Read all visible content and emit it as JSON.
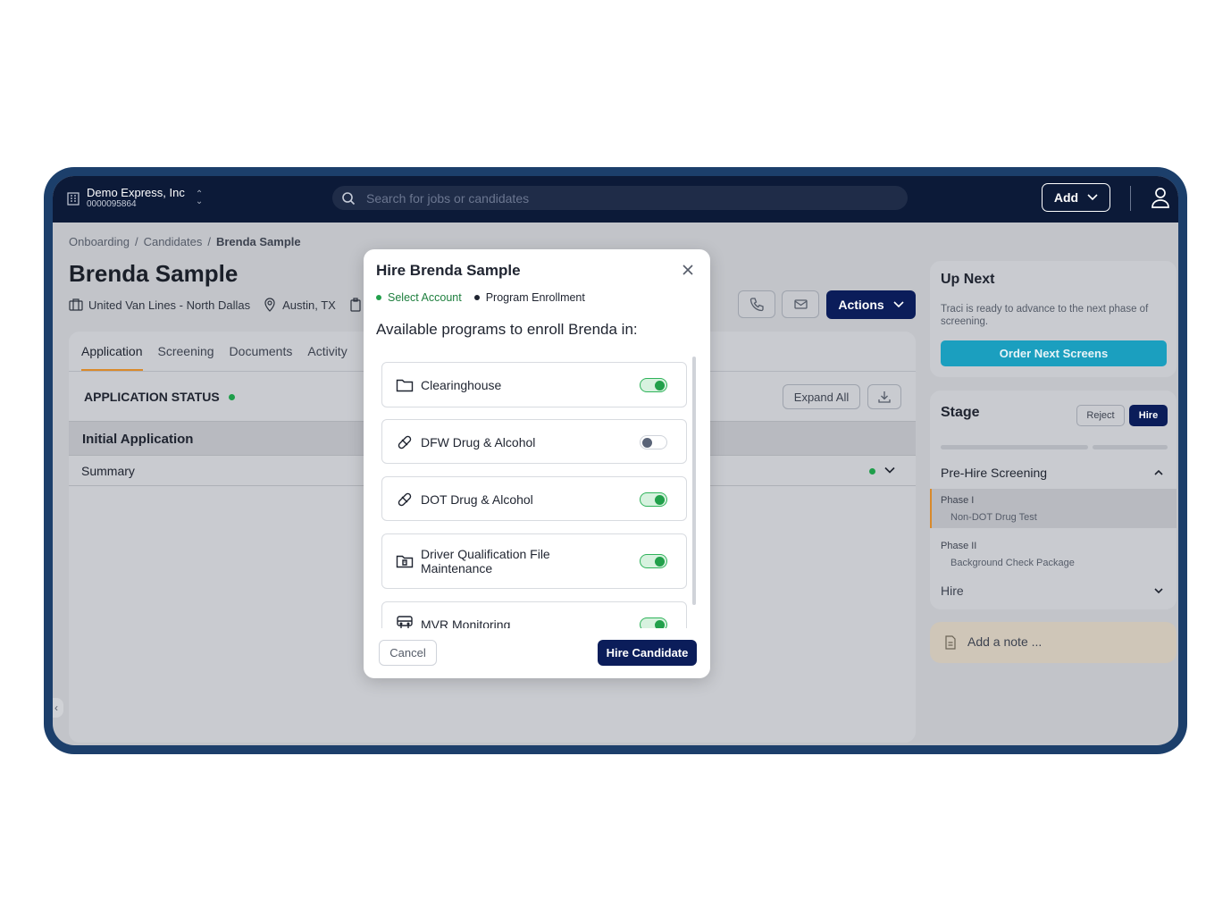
{
  "topbar": {
    "org_name": "Demo Express, Inc",
    "org_id": "0000095864",
    "search_placeholder": "Search for jobs or candidates",
    "add_label": "Add"
  },
  "breadcrumb": [
    "Onboarding",
    "Candidates",
    "Brenda Sample"
  ],
  "candidate": {
    "name": "Brenda Sample",
    "company": "United Van Lines - North Dallas",
    "location": "Austin, TX"
  },
  "header": {
    "actions_label": "Actions"
  },
  "tabs": [
    "Application",
    "Screening",
    "Documents",
    "Activity"
  ],
  "application": {
    "status_label": "APPLICATION STATUS",
    "expand_all_label": "Expand All",
    "section_title": "Initial Application",
    "summary_label": "Summary"
  },
  "up_next": {
    "title": "Up Next",
    "text": "Traci is ready to advance to the next phase of screening.",
    "button": "Order Next Screens"
  },
  "stage": {
    "title": "Stage",
    "reject_label": "Reject",
    "hire_label": "Hire",
    "group": "Pre-Hire Screening",
    "phases": [
      {
        "label": "Phase I",
        "desc": "Non-DOT Drug Test"
      },
      {
        "label": "Phase II",
        "desc": "Background Check Package"
      }
    ],
    "hire_row": "Hire"
  },
  "note": {
    "label": "Add a note ..."
  },
  "modal": {
    "title": "Hire Brenda Sample",
    "steps": [
      "Select Account",
      "Program Enrollment"
    ],
    "subtitle": "Available programs to enroll Brenda in:",
    "programs": [
      {
        "label": "Clearinghouse",
        "icon": "folder-icon",
        "enabled": true
      },
      {
        "label": "DFW Drug & Alcohol",
        "icon": "pill-icon",
        "enabled": false
      },
      {
        "label": "DOT Drug & Alcohol",
        "icon": "pill-icon",
        "enabled": true
      },
      {
        "label": "Driver Qualification File Maintenance",
        "icon": "folder-file-icon",
        "enabled": true
      },
      {
        "label": "MVR Monitoring",
        "icon": "truck-icon",
        "enabled": true
      }
    ],
    "cancel_label": "Cancel",
    "confirm_label": "Hire Candidate"
  },
  "colors": {
    "navy": "#0b1d5a",
    "topbar": "#0c1a38",
    "accent_teal": "#1b9fbf",
    "toggle_on": "#22a04b",
    "tab_underline": "#d98a2b"
  }
}
